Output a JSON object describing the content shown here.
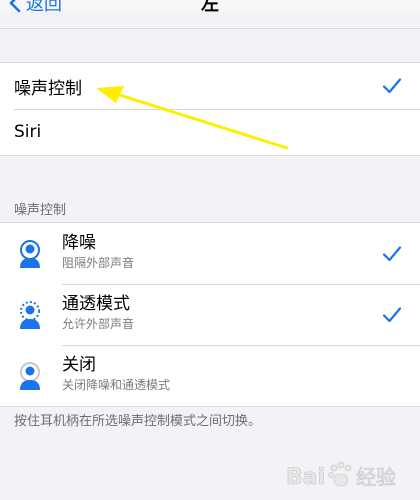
{
  "nav": {
    "back_label": "返回",
    "title": "左"
  },
  "press_hold": {
    "items": [
      {
        "label": "噪声控制",
        "selected": true
      },
      {
        "label": "Siri",
        "selected": false
      }
    ]
  },
  "noise_section": {
    "header": "噪声控制",
    "modes": [
      {
        "title": "降噪",
        "subtitle": "阻隔外部声音",
        "icon": "noise-cancellation-icon",
        "selected": true
      },
      {
        "title": "通透模式",
        "subtitle": "允许外部声音",
        "icon": "transparency-icon",
        "selected": true
      },
      {
        "title": "关闭",
        "subtitle": "关闭降噪和通透模式",
        "icon": "off-icon",
        "selected": false
      }
    ],
    "footer": "按住耳机柄在所选噪声控制模式之间切换。"
  },
  "colors": {
    "accent": "#1a73e8",
    "annotation": "#ffee00",
    "background": "#f2f2f7"
  },
  "watermark": {
    "text": "Bai 经验"
  }
}
